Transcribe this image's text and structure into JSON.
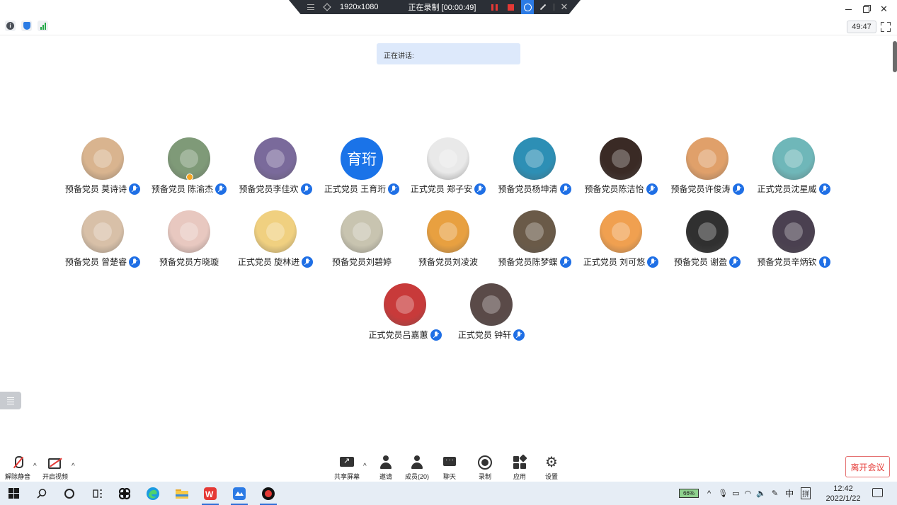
{
  "recording_bar": {
    "resolution": "1920x1080",
    "status": "正在录制 [00:00:49]"
  },
  "info_bar": {
    "timer": "49:47"
  },
  "speaking": {
    "label": "正在讲话:"
  },
  "participants": [
    {
      "name": "预备党员 莫诗诗",
      "avatar": "avatar-bear-icon",
      "color": "#d9b48f",
      "mic": "muted"
    },
    {
      "name": "预备党员 陈渝杰",
      "avatar": "avatar-photo-icon",
      "color": "#7f9a78",
      "mic": "muted",
      "host": true
    },
    {
      "name": "预备党员李佳欢",
      "avatar": "avatar-cartoon-icon",
      "color": "#7a6a9b",
      "mic": "muted"
    },
    {
      "name": "正式党员 王育珩",
      "avatar_text": "育珩",
      "color": "#1a73e8",
      "mic": "muted"
    },
    {
      "name": "正式党员 郑子安",
      "avatar": "avatar-sketch-icon",
      "color": "#e9e9e9",
      "mic": "muted"
    },
    {
      "name": "预备党员杨坤清",
      "avatar": "avatar-anime-icon",
      "color": "#2d8fb5",
      "mic": "muted"
    },
    {
      "name": "预备党员陈洁怡",
      "avatar": "avatar-photo-icon",
      "color": "#3a2a25",
      "mic": "muted"
    },
    {
      "name": "预备党员许俊涛",
      "avatar": "avatar-cartoon-icon",
      "color": "#e0a06a",
      "mic": "muted"
    },
    {
      "name": "正式党员沈星威",
      "avatar": "avatar-cartoon-icon",
      "color": "#6fb7b9",
      "mic": "muted"
    },
    {
      "name": "预备党员 曾楚睿",
      "avatar": "avatar-cat-icon",
      "color": "#d8c0a8",
      "mic": "muted"
    },
    {
      "name": "预备党员方晓璇",
      "avatar": "avatar-photo-icon",
      "color": "#e8c8c0",
      "mic": "none"
    },
    {
      "name": "正式党员 旋林进",
      "avatar": "avatar-sketch-icon",
      "color": "#f0d080",
      "mic": "muted"
    },
    {
      "name": "预备党员刘碧婷",
      "avatar": "avatar-photo-icon",
      "color": "#c8c4b0",
      "mic": "none"
    },
    {
      "name": "预备党员刘凌波",
      "avatar": "avatar-anime-icon",
      "color": "#e8a040",
      "mic": "none"
    },
    {
      "name": "预备党员陈梦蝶",
      "avatar": "avatar-photo-icon",
      "color": "#6a5a48",
      "mic": "muted"
    },
    {
      "name": "正式党员 刘可悠",
      "avatar": "avatar-tiger-icon",
      "color": "#f0a050",
      "mic": "muted"
    },
    {
      "name": "预备党员 谢盈",
      "avatar": "avatar-ghost-icon",
      "color": "#303030",
      "mic": "muted"
    },
    {
      "name": "预备党员辛炳钦",
      "avatar": "avatar-photo-icon",
      "color": "#4a4050",
      "mic": "live"
    },
    {
      "name": "正式党员吕嘉蕙",
      "avatar": "avatar-sailor-icon",
      "color": "#c83a3a",
      "mic": "muted"
    },
    {
      "name": "正式党员 钟轩",
      "avatar": "avatar-photo-icon",
      "color": "#5a4a48",
      "mic": "muted"
    }
  ],
  "toolbar": {
    "unmute": "解除静音",
    "start_video": "开启视频",
    "share_screen": "共享屏幕",
    "invite": "邀请",
    "members": "成员(20)",
    "chat": "聊天",
    "record": "录制",
    "apps": "应用",
    "settings": "设置",
    "leave": "离开会议"
  },
  "taskbar": {
    "battery": "66%",
    "ime": "中",
    "ime2": "拼",
    "time": "12:42",
    "date": "2022/1/22"
  },
  "colors": {
    "accent": "#1f6fe5",
    "leave": "#e53935",
    "speaking_bg": "#dde9fb"
  }
}
